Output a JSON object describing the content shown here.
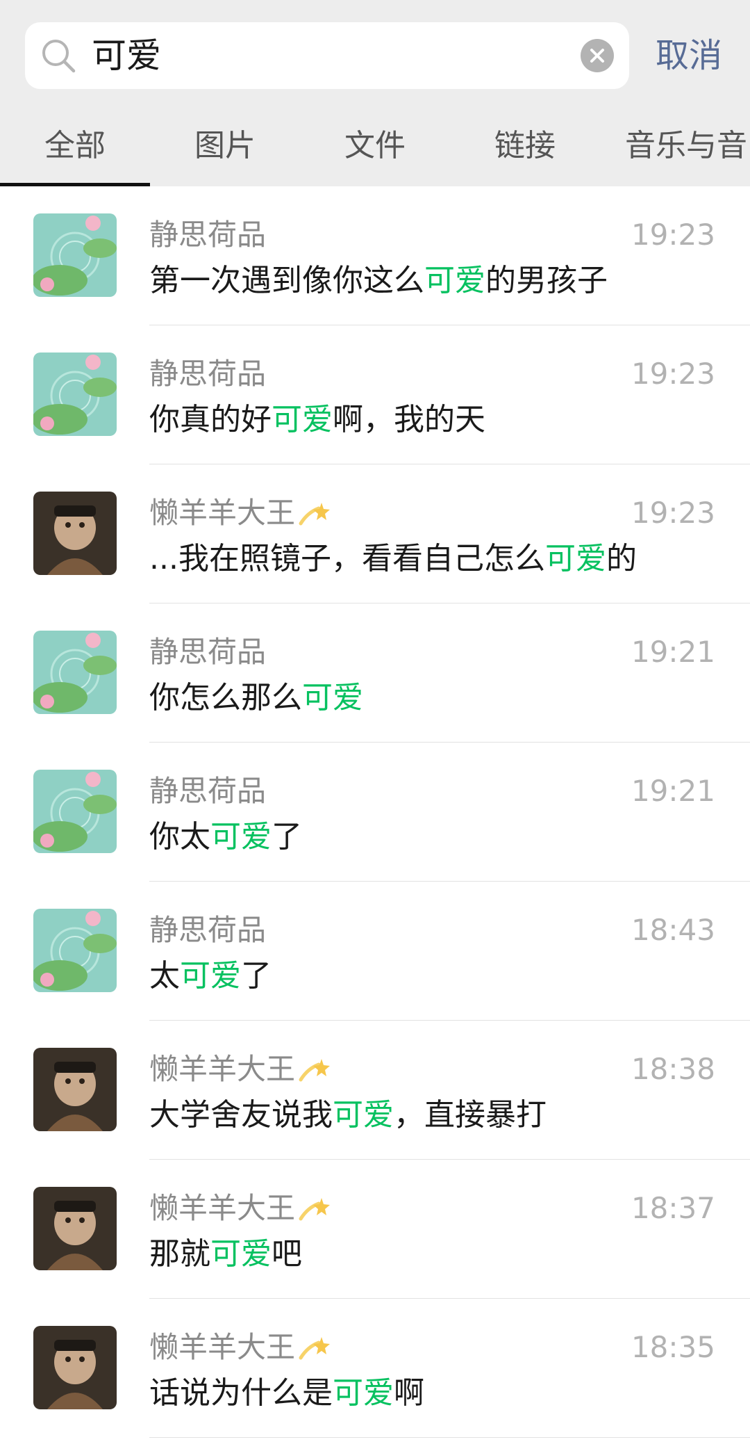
{
  "search": {
    "query": "可爱",
    "cancel_label": "取消"
  },
  "tabs": [
    {
      "label": "全部",
      "active": true
    },
    {
      "label": "图片",
      "active": false
    },
    {
      "label": "文件",
      "active": false
    },
    {
      "label": "链接",
      "active": false
    },
    {
      "label": "音乐与音",
      "active": false
    }
  ],
  "colors": {
    "highlight": "#07c160",
    "cancel": "#576b95",
    "topbar_bg": "#ededed"
  },
  "results": [
    {
      "name": "静思荷品",
      "time": "19:23",
      "before": "第一次遇到像你这么",
      "keyword": "可爱",
      "after": "的男孩子",
      "avatar": "lotus-avatar"
    },
    {
      "name": "静思荷品",
      "time": "19:23",
      "before": "你真的好",
      "keyword": "可爱",
      "after": "啊，我的天",
      "avatar": "lotus-avatar"
    },
    {
      "name": "懒羊羊大王",
      "time": "19:23",
      "before": "...我在照镜子，看看自己怎么",
      "keyword": "可爱",
      "after": "的",
      "avatar": "monkey-avatar",
      "emoji": "dizzy-star-icon"
    },
    {
      "name": "静思荷品",
      "time": "19:21",
      "before": "你怎么那么",
      "keyword": "可爱",
      "after": "",
      "avatar": "lotus-avatar"
    },
    {
      "name": "静思荷品",
      "time": "19:21",
      "before": "你太",
      "keyword": "可爱",
      "after": "了",
      "avatar": "lotus-avatar"
    },
    {
      "name": "静思荷品",
      "time": "18:43",
      "before": "太",
      "keyword": "可爱",
      "after": "了",
      "avatar": "lotus-avatar"
    },
    {
      "name": "懒羊羊大王",
      "time": "18:38",
      "before": "大学舍友说我",
      "keyword": "可爱",
      "after": "，直接暴打",
      "avatar": "monkey-avatar",
      "emoji": "dizzy-star-icon"
    },
    {
      "name": "懒羊羊大王",
      "time": "18:37",
      "before": "那就",
      "keyword": "可爱",
      "after": "吧",
      "avatar": "monkey-avatar",
      "emoji": "dizzy-star-icon"
    },
    {
      "name": "懒羊羊大王",
      "time": "18:35",
      "before": "话说为什么是",
      "keyword": "可爱",
      "after": "啊",
      "avatar": "monkey-avatar",
      "emoji": "dizzy-star-icon"
    }
  ]
}
